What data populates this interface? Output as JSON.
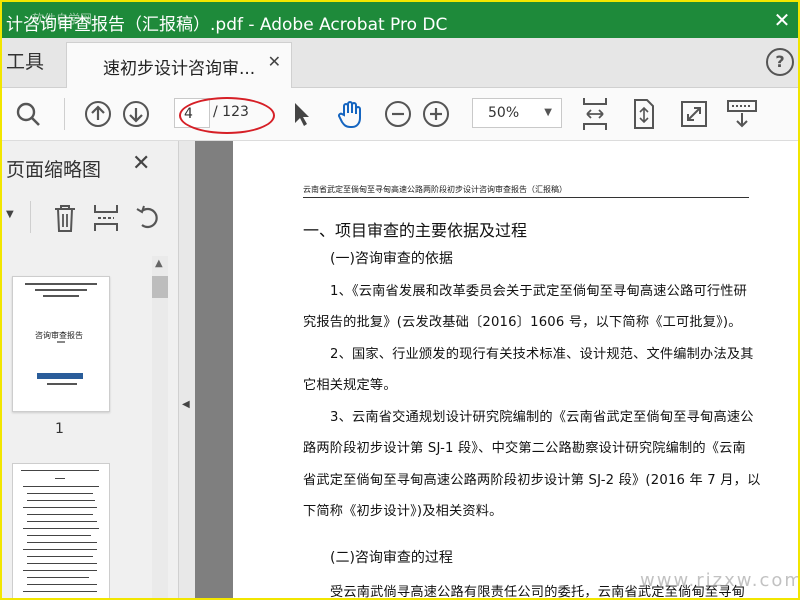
{
  "titlebar": {
    "title": "计咨询审查报告（汇报稿）.pdf - Adobe Acrobat Pro DC",
    "watermark": "软件自学网"
  },
  "tabs": {
    "tools_label": "工具",
    "document_label": "速初步设计咨询审...",
    "help_label": "?"
  },
  "toolbar": {
    "page_current": "4",
    "page_total": "/ 123",
    "zoom_value": "50%",
    "accent_color": "#1e8a3a",
    "highlight_color": "#d61f26"
  },
  "panel": {
    "title": "页面缩略图",
    "thumbnail_1": {
      "page_number": "1",
      "heading": "咨询审查报告"
    }
  },
  "document": {
    "header": "云南省武定至倘甸至寻甸高速公路两阶段初步设计咨询审查报告（汇报稿）",
    "heading1": "一、项目审查的主要依据及过程",
    "heading2a": "(一)咨询审查的依据",
    "para1_line1": "1、《云南省发展和改革委员会关于武定至倘甸至寻甸高速公路可行性研",
    "para1_line2": "究报告的批复》(云发改基础〔2016〕1606 号，以下简称《工可批复》)。",
    "para2_line1": "2、国家、行业颁发的现行有关技术标准、设计规范、文件编制办法及其",
    "para2_line2": "它相关规定等。",
    "para3_line1": "3、云南省交通规划设计研究院编制的《云南省武定至倘甸至寻甸高速公",
    "para3_line2": "路两阶段初步设计第 SJ-1 段》、中交第二公路勘察设计研究院编制的《云南",
    "para3_line3": "省武定至倘甸至寻甸高速公路两阶段初步设计第 SJ-2 段》(2016 年 7 月，以",
    "para3_line4": "下简称《初步设计》)及相关资料。",
    "heading2b": "(二)咨询审查的过程",
    "para4_line1": "受云南武倘寻高速公路有限责任公司的委托，云南省武定至倘甸至寻甸"
  },
  "watermark": "www.rjzxw.com"
}
